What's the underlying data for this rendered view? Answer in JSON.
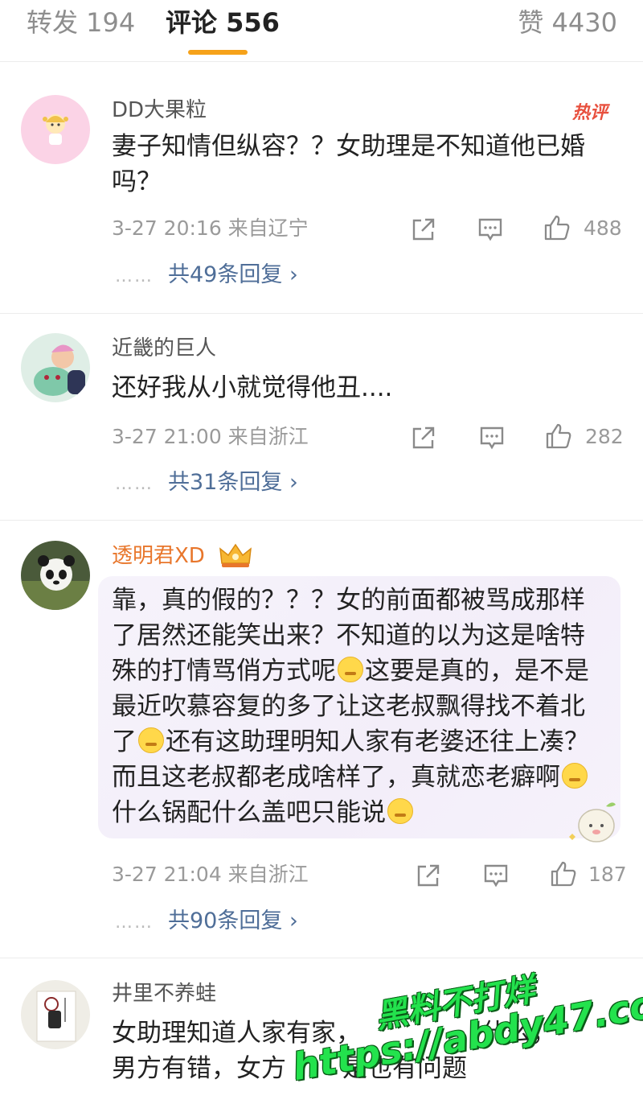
{
  "tabs": {
    "forward": "转发 194",
    "comments": "评论 556",
    "likes": "赞 4430"
  },
  "comments": [
    {
      "user": "DD大果粒",
      "badge": "热评",
      "text": "妻子知情但纵容？？女助理是不知道他已婚吗？",
      "meta": "3-27 20:16 来自辽宁",
      "likes": "488",
      "replies": "共49条回复 ›",
      "avatar_icon": "cartoon-girl-avatar"
    },
    {
      "user": "近畿的巨人",
      "text": "还好我从小就觉得他丑....",
      "meta": "3-27 21:00 来自浙江",
      "likes": "282",
      "replies": "共31条回复 ›",
      "avatar_icon": "pokemon-hug-avatar"
    },
    {
      "user": "透明君XD",
      "text_parts": [
        "靠，真的假的？？？女的前面都被骂成那样了居然还能笑出来？不知道的以为这是啥特殊的打情骂俏方式呢",
        "这要是真的，是不是最近吹慕容复的多了让这老叔飘得找不着北了",
        "还有这助理明知人家有老婆还往上凑？而且这老叔都老成啥样了，真就恋老癖啊",
        "什么锅配什么盖吧只能说"
      ],
      "meta": "3-27 21:04 来自浙江",
      "likes": "187",
      "replies": "共90条回复 ›",
      "avatar_icon": "panda-avatar"
    },
    {
      "user": "井里不养蛙",
      "text_line1": "女助理知道人家有家，",
      "text_line1b": "什么，",
      "text_line2": "男方有错，女方",
      "text_line2b": "是也有问题",
      "avatar_icon": "product-photo-avatar"
    }
  ],
  "dots": "……",
  "watermark": {
    "line1": "黑料不打烊",
    "line2": "https://abdy47.com"
  },
  "colors": {
    "accent_underline": "#f6a21a",
    "reply_link": "#4f6e98",
    "vip_name": "#e8762b",
    "hot_badge": "#e8503e",
    "watermark": "#23e24d"
  }
}
